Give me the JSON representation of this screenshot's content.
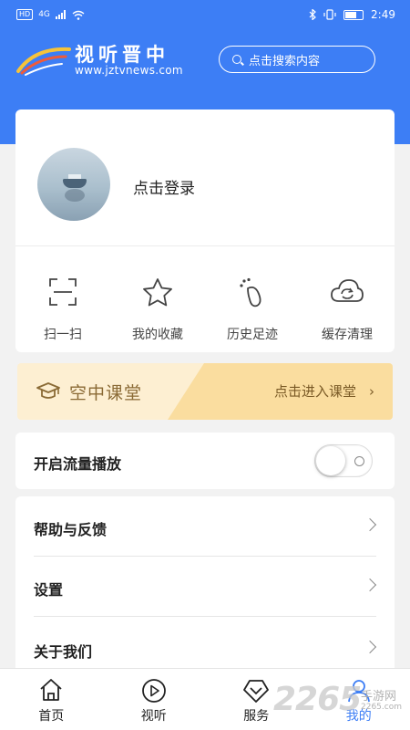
{
  "status_bar": {
    "hd": "HD",
    "signal": "4G",
    "time": "2:49"
  },
  "header": {
    "logo_title": "视听晋中",
    "logo_url": "www.jztvnews.com",
    "search_placeholder": "点击搜索内容"
  },
  "profile": {
    "login_text": "点击登录"
  },
  "quick_actions": [
    {
      "label": "扫一扫",
      "icon": "scan-icon"
    },
    {
      "label": "我的收藏",
      "icon": "star-icon"
    },
    {
      "label": "历史足迹",
      "icon": "footprint-icon"
    },
    {
      "label": "缓存清理",
      "icon": "cloud-refresh-icon"
    }
  ],
  "banner": {
    "title": "空中课堂",
    "action": "点击进入课堂",
    "chevron": "›"
  },
  "settings": {
    "traffic_play_label": "开启流量播放",
    "traffic_play_enabled": false
  },
  "menu": [
    {
      "label": "帮助与反馈"
    },
    {
      "label": "设置"
    },
    {
      "label": "关于我们"
    }
  ],
  "tabs": [
    {
      "label": "首页",
      "icon": "home-icon"
    },
    {
      "label": "视听",
      "icon": "play-icon"
    },
    {
      "label": "服务",
      "icon": "service-icon"
    },
    {
      "label": "我的",
      "icon": "user-icon",
      "active": true
    }
  ],
  "watermark": {
    "number": "2265",
    "text": "手游网",
    "url": "2265.com"
  },
  "colors": {
    "primary": "#3d7ef5",
    "banner_light": "#fdefd2",
    "banner_dark": "#fadd9f",
    "banner_text": "#8a6a35"
  }
}
